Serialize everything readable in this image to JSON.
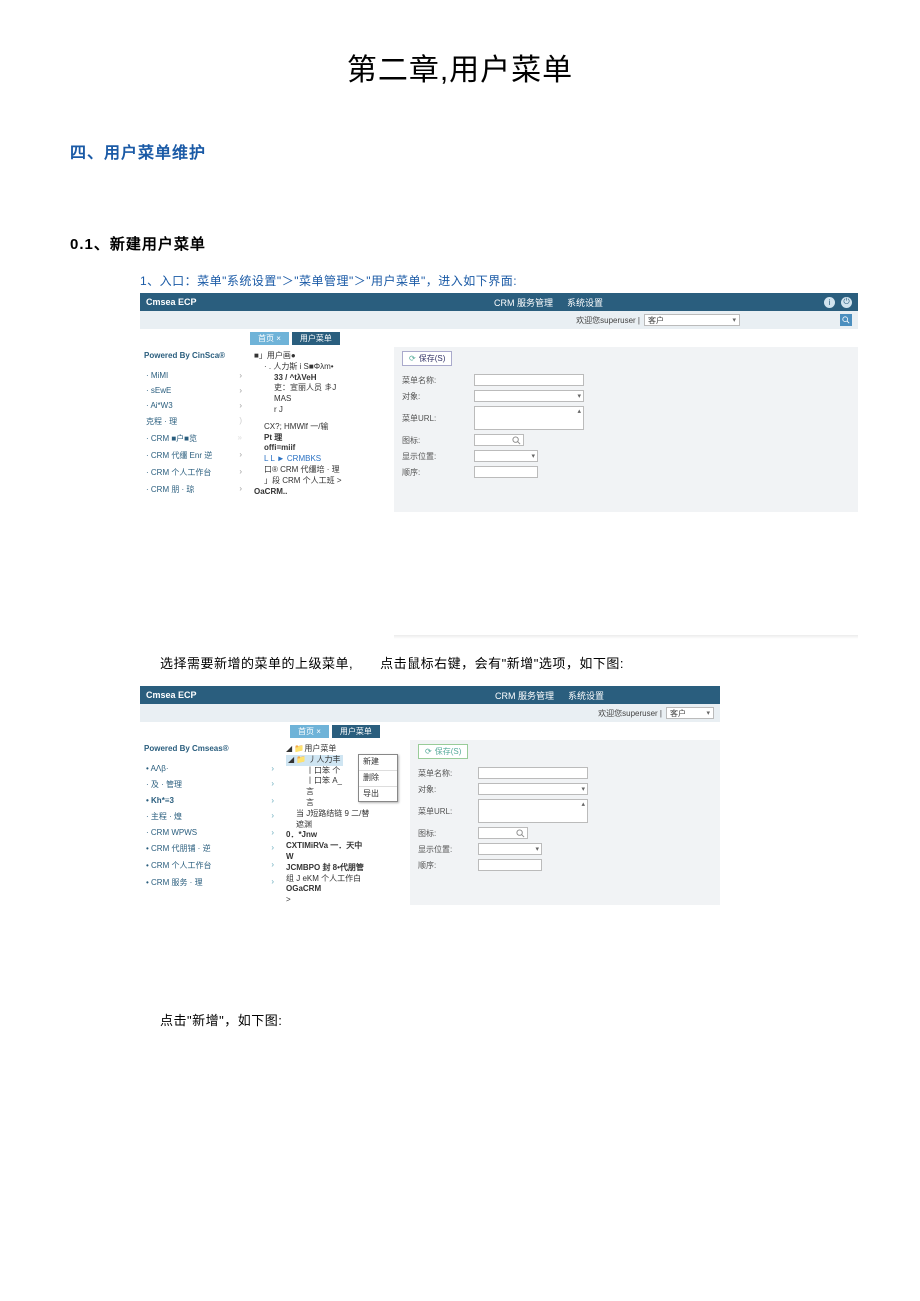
{
  "page_title": "第二章,用户菜单",
  "section4": "四、用户菜单维护",
  "section01": "0.1、新建用户菜单",
  "step1": "1、入口：菜单\"系统设置\"＞\"菜单管理\"＞\"用户菜单\"，进入如下界面:",
  "caption1": "选择需要新增的菜单的上级菜单,　　点击鼠标右键，会有\"新增\"选项，如下图:",
  "caption2": "点击\"新增\"，如下图:",
  "app": {
    "brand": "Cmsea ECP",
    "tab_service": "CRM 服务管理",
    "tab_settings": "系统设置",
    "welcome": "欢迎您superuser  |",
    "client_label": "客户",
    "crumb_home": "首页  ×",
    "crumb_cur": "用户菜单",
    "save_btn": "保存(S)",
    "refresh_glyph": "⟳",
    "info_glyph": "i",
    "power_glyph": "⏻",
    "caret": "▾",
    "search_glyph": "🔍"
  },
  "form": {
    "name": "菜单名称:",
    "object": "对象:",
    "url": "菜单URL:",
    "icon": "图标:",
    "pos": "显示位置:",
    "order": "顺序:"
  },
  "form2": {
    "name": "菜单名称:",
    "object": "对象:",
    "url": "菜单URL:",
    "icon": "图标:",
    "pos": "显示位置:",
    "order": "顺序:"
  },
  "sidebar1": {
    "powered": "Powered By CinSca®",
    "items": [
      "· MiMI",
      "· sEwE",
      "· Ai*W3",
      "克程 · 理",
      "· CRM ■户■览",
      "· CRM 代缰 Enr 逆",
      "· CRM 个人工作台",
      "· CRM 朋 · 琼"
    ]
  },
  "tree1": {
    "l0": "■」用户画●",
    "l1": "·  .  人力斯 i S■Φλm•",
    "l2": "33 / ^tλVeH",
    "l3": "吏：宣丽人员 丯J",
    "l4": "MAS",
    "l5": "r J",
    "l6": "CX?; HMWlf 一/输",
    "l7": "Pt 理",
    "l8": "offi=miif",
    "l9": "L L ► CRMBKS",
    "l10": "口® CRM 代缰培 · 理",
    "l11": "」段 CRM 个人工班 >",
    "l12": "OaCRM.."
  },
  "sidebar2": {
    "powered": "Powered By Cmseas®",
    "items": [
      "•   AΛβ·",
      "· 及 · 管理",
      "•  Kh*≡3",
      "· 主程 · 煌",
      "· CRM WPWS",
      "• CRM 代朋铺 · 逆",
      "• CRM 个人工作台",
      "• CRM 服务 · 理"
    ]
  },
  "tree2": {
    "l0": "◢ 📁用户菜单",
    "l1": "◢ 📁 丿人力丰",
    "l2": "丨口笨 个",
    "l3": "丨口笨 A_",
    "l4": "言",
    "l5": "言",
    "l6": "当 J短路结链 9 二/替",
    "l7": "遮渊",
    "l8": "0．*Jnw",
    "l9": "CXTIMiRVa 一．天中",
    "l10": "W",
    "l11": "JCMBPO  封 8•代朋管",
    "l12": "组  J eKM 个人工作白",
    "l13": "OGaCRM",
    "l14": ">"
  },
  "ctx": {
    "new": "新建",
    "del": "删除",
    "exp": "导出"
  }
}
